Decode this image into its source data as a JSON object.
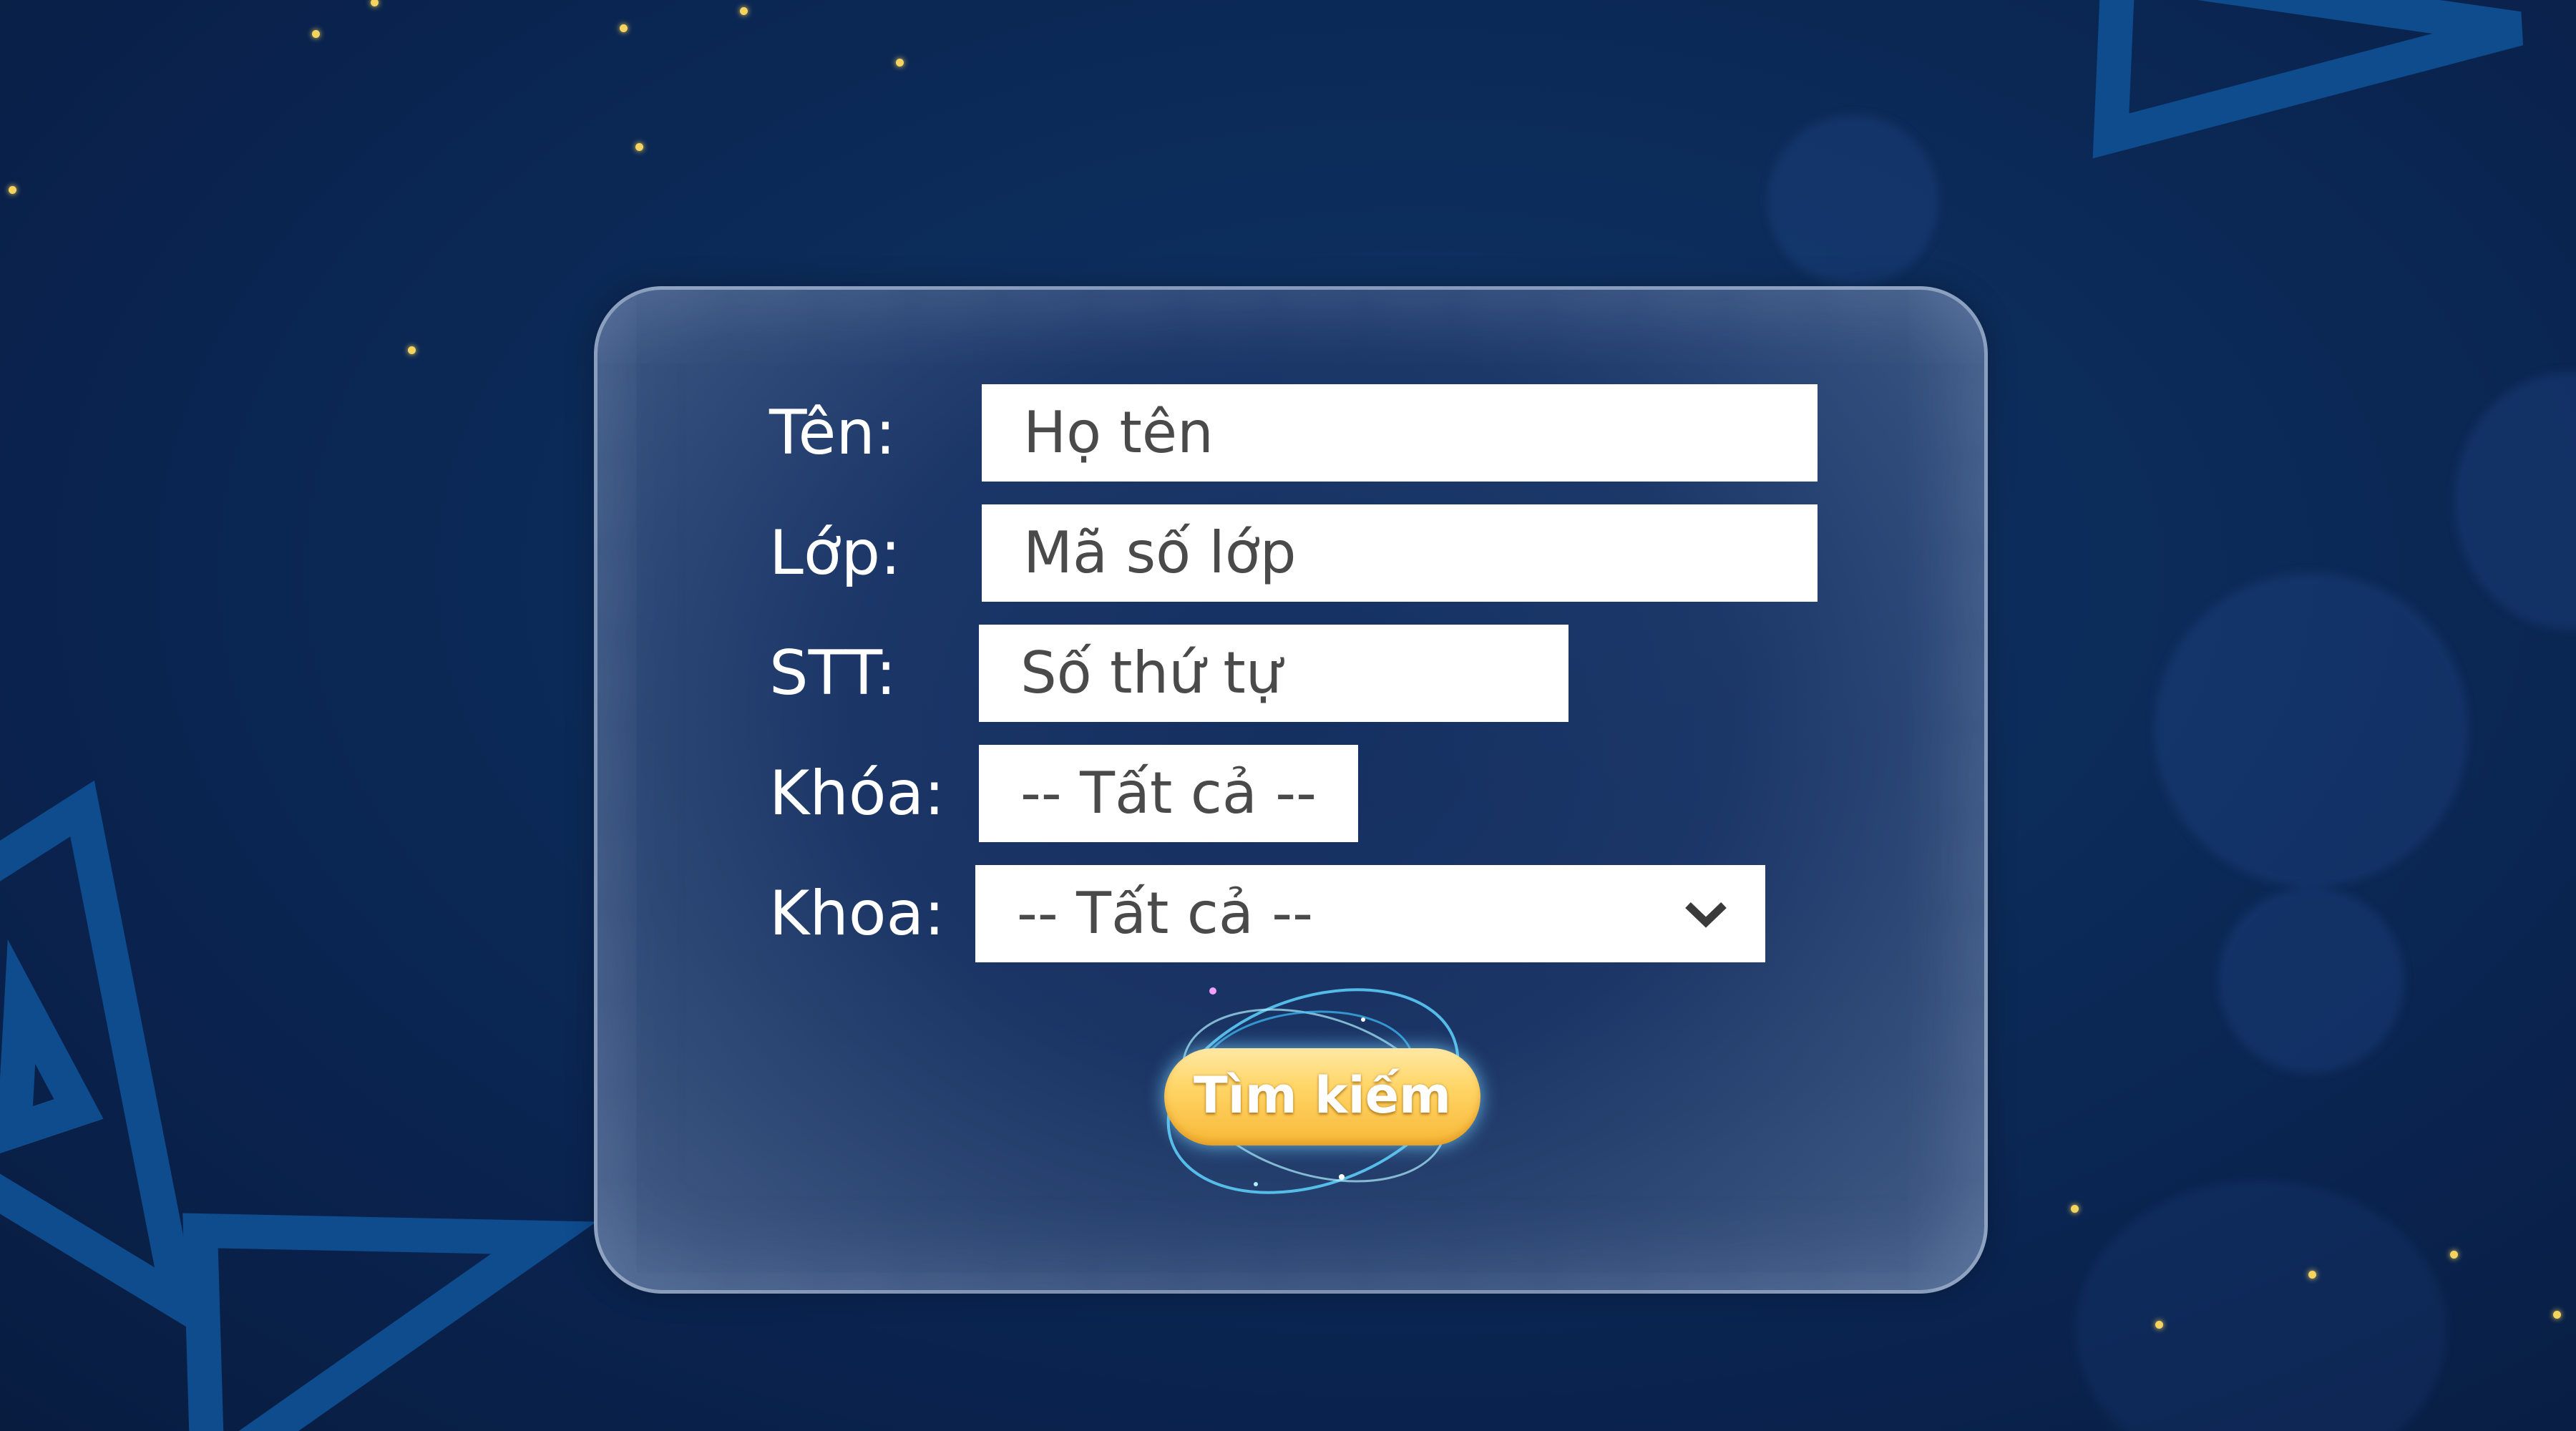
{
  "form": {
    "name": {
      "label": "Tên:",
      "placeholder": "Họ tên"
    },
    "class": {
      "label": "Lớp:",
      "placeholder": "Mã số lớp"
    },
    "index": {
      "label": "STT:",
      "placeholder": "Số thứ tự"
    },
    "course": {
      "label": "Khóa:",
      "value": "-- Tất cả --"
    },
    "faculty": {
      "label": "Khoa:",
      "value": "-- Tất cả --"
    }
  },
  "search_button": {
    "label": "Tìm kiếm"
  },
  "colors": {
    "background": "#0c2c5a",
    "field_background": "#ffffff",
    "field_text": "#4a4a4a",
    "button": "#ffd566",
    "sparkle": "#f4d35e",
    "decor_shape": "#0e4c8e"
  },
  "icons": {
    "select_arrow": "chevron-down-icon"
  }
}
